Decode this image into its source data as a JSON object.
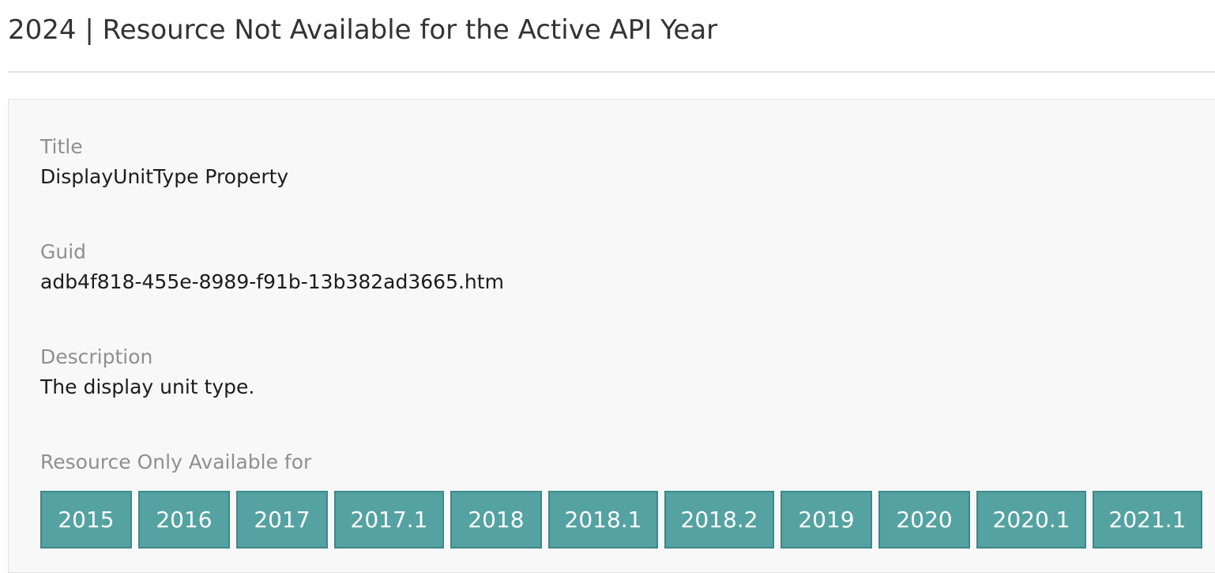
{
  "header": {
    "title": "2024 | Resource Not Available for the Active API Year"
  },
  "fields": {
    "title_label": "Title",
    "title_value": "DisplayUnitType Property",
    "guid_label": "Guid",
    "guid_value": "adb4f818-455e-8989-f91b-13b382ad3665.htm",
    "description_label": "Description",
    "description_value": "The display unit type.",
    "availability_label": "Resource Only Available for"
  },
  "years": [
    "2015",
    "2016",
    "2017",
    "2017.1",
    "2018",
    "2018.1",
    "2018.2",
    "2019",
    "2020",
    "2020.1",
    "2021.1"
  ],
  "colors": {
    "year_button_bg": "#55a2a2",
    "year_button_border": "#3f8787",
    "card_bg": "#f8f8f8",
    "label_text": "#8f8f8f"
  }
}
